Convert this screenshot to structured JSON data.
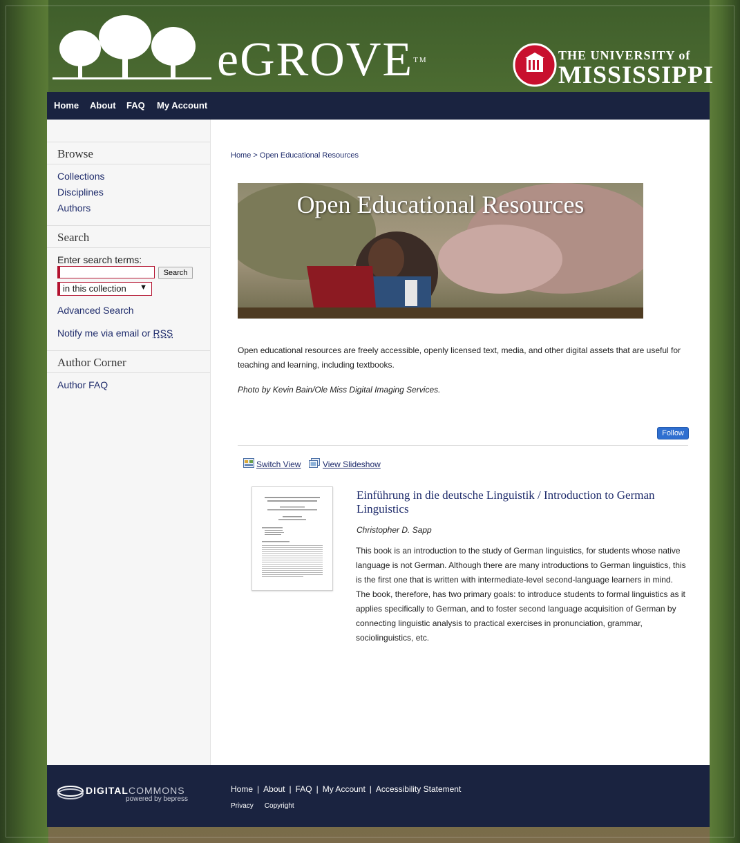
{
  "header": {
    "logo_text": "eGROVE",
    "logo_tm": "TM",
    "university_the": "THE UNIVERSITY of",
    "university_name": "MISSISSIPPI"
  },
  "nav": {
    "items": [
      "Home",
      "About",
      "FAQ",
      "My Account"
    ]
  },
  "sidebar": {
    "browse_heading": "Browse",
    "browse_links": [
      "Collections",
      "Disciplines",
      "Authors"
    ],
    "search_heading": "Search",
    "search_label": "Enter search terms:",
    "search_value": "",
    "search_button": "Search",
    "scope_selected": "in this collection",
    "advanced_search": "Advanced Search",
    "notify_text": "Notify me via email or ",
    "notify_rss": "RSS",
    "author_heading": "Author Corner",
    "author_links": [
      "Author FAQ"
    ]
  },
  "breadcrumb": {
    "home": "Home",
    "sep": " > ",
    "current": "Open Educational Resources"
  },
  "banner": {
    "title": "Open Educational Resources"
  },
  "description": "Open educational resources are freely accessible, openly licensed text, media, and other digital assets that are useful for teaching and learning, including textbooks.",
  "photo_credit": "Photo by Kevin Bain/Ole Miss Digital Imaging Services.",
  "follow_button": "Follow",
  "view_controls": {
    "switch_view": "Switch View",
    "view_slideshow": "View Slideshow"
  },
  "item": {
    "title": "Einführung in die deutsche Linguistik / Introduction to German Linguistics",
    "author": "Christopher D. Sapp",
    "abstract": "This book is an introduction to the study of German linguistics, for students whose native language is not German. Although there are many introductions to German linguistics, this is the first one that is written with intermediate-level second-language learners in mind. The book, therefore, has two primary goals: to introduce students to formal linguistics as it applies specifically to German, and to foster second language acquisition of German by connecting linguistic analysis to practical exercises in pronunciation, grammar, sociolinguistics, etc."
  },
  "footer": {
    "dc_bold": "DIGITAL",
    "dc_thin": "COMMONS",
    "dc_sub": "powered by bepress",
    "links": [
      "Home",
      "About",
      "FAQ",
      "My Account",
      "Accessibility Statement"
    ],
    "sub_links": [
      "Privacy",
      "Copyright"
    ]
  },
  "colors": {
    "nav_bg": "#1a2340",
    "link": "#1e2b6b",
    "accent_red": "#b3122f",
    "follow_blue": "#2f6fd0"
  }
}
